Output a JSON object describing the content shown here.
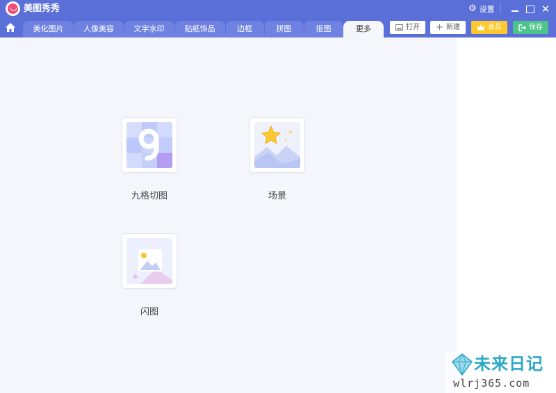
{
  "app": {
    "title": "美图秀秀"
  },
  "titlebar": {
    "settings_label": "设置"
  },
  "tabs": [
    {
      "label": "美化图片"
    },
    {
      "label": "人像美容"
    },
    {
      "label": "文字水印"
    },
    {
      "label": "贴纸饰品"
    },
    {
      "label": "边框"
    },
    {
      "label": "拼图"
    },
    {
      "label": "抠图"
    },
    {
      "label": "更多",
      "active": true
    }
  ],
  "toolbar": {
    "open_label": "打开",
    "new_label": "新建",
    "vip_label": "会员",
    "save_label": "保存"
  },
  "tools": [
    {
      "label": "九格切图",
      "icon": "nine-grid-icon"
    },
    {
      "label": "场景",
      "icon": "scene-star-icon"
    },
    {
      "label": "闪图",
      "icon": "flash-image-icon"
    }
  ],
  "watermark": {
    "title": "未来日记",
    "url": "wlrj365.com"
  },
  "colors": {
    "header": "#5b6fd9",
    "tab": "#6f82e2",
    "vip": "#ffc82c",
    "save": "#4cc38a",
    "content_bg": "#f4f6fb"
  }
}
